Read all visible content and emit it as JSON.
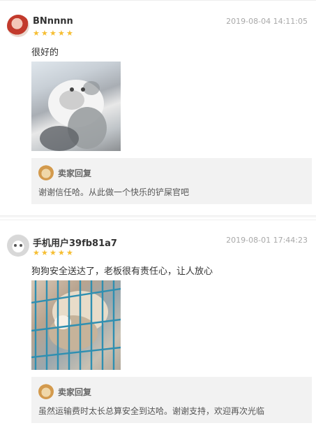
{
  "reviews": [
    {
      "username": "BNnnnn",
      "time": "2019-08-04 14:11:05",
      "rating": 5,
      "text": "很好的",
      "photo_desc_icon": "cat-photo",
      "reply": {
        "title": "卖家回复",
        "text": "谢谢信任哈。从此做一个快乐的铲屎官吧"
      }
    },
    {
      "username": "手机用户39fb81a7",
      "time": "2019-08-01 17:44:23",
      "rating": 5,
      "text": "狗狗安全送达了，老板很有责任心，让人放心",
      "photo_desc_icon": "dog-in-cage-photo",
      "reply": {
        "title": "卖家回复",
        "text": "虽然运输费时太长总算安全到达哈。谢谢支持，欢迎再次光临"
      }
    }
  ],
  "colors": {
    "star": "#f6be32",
    "reply_bg": "#f2f2f2",
    "time": "#a8a8a8"
  }
}
